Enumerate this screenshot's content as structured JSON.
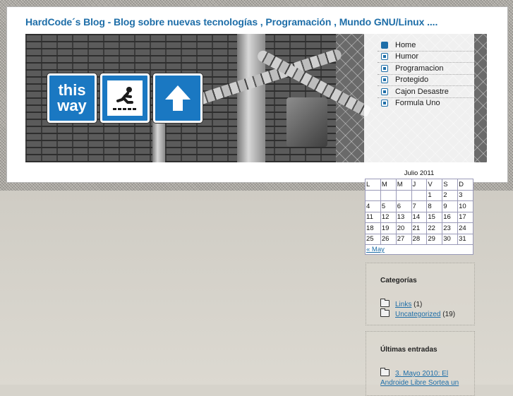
{
  "header": {
    "site_title": "HardCode´s Blog - Blog sobre nuevas tecnologías , Programación , Mundo GNU/Linux ...."
  },
  "banner": {
    "signs": [
      {
        "icon": "this-way-sign-icon",
        "lines": [
          "this",
          "way"
        ]
      },
      {
        "icon": "slippery-floor-sign-icon"
      },
      {
        "icon": "up-arrow-sign-icon"
      }
    ]
  },
  "nav": {
    "items": [
      {
        "label": "Home",
        "active": true
      },
      {
        "label": "Humor"
      },
      {
        "label": "Programacion"
      },
      {
        "label": "Protegido"
      },
      {
        "label": "Cajon Desastre"
      },
      {
        "label": "Formula Uno"
      }
    ]
  },
  "calendar": {
    "caption": "Julio 2011",
    "weekdays": [
      "L",
      "M",
      "M",
      "J",
      "V",
      "S",
      "D"
    ],
    "weeks": [
      [
        "",
        "",
        "",
        "",
        "1",
        "2",
        "3"
      ],
      [
        "4",
        "5",
        "6",
        "7",
        "8",
        "9",
        "10"
      ],
      [
        "11",
        "12",
        "13",
        "14",
        "15",
        "16",
        "17"
      ],
      [
        "18",
        "19",
        "20",
        "21",
        "22",
        "23",
        "24"
      ],
      [
        "25",
        "26",
        "27",
        "28",
        "29",
        "30",
        "31"
      ]
    ],
    "prev_link": "« May"
  },
  "categories": {
    "title": "Categorías",
    "items": [
      {
        "name": "Links",
        "count": "(1)"
      },
      {
        "name": "Uncategorized",
        "count": "(19)"
      }
    ]
  },
  "recent": {
    "title": "Últimas entradas",
    "items": [
      {
        "line1": "3. Mayo 2010: El",
        "line2": "Androide Libre Sortea un"
      }
    ]
  },
  "colors": {
    "link_blue": "#1e6ea8",
    "sign_blue": "#1a78c2"
  }
}
